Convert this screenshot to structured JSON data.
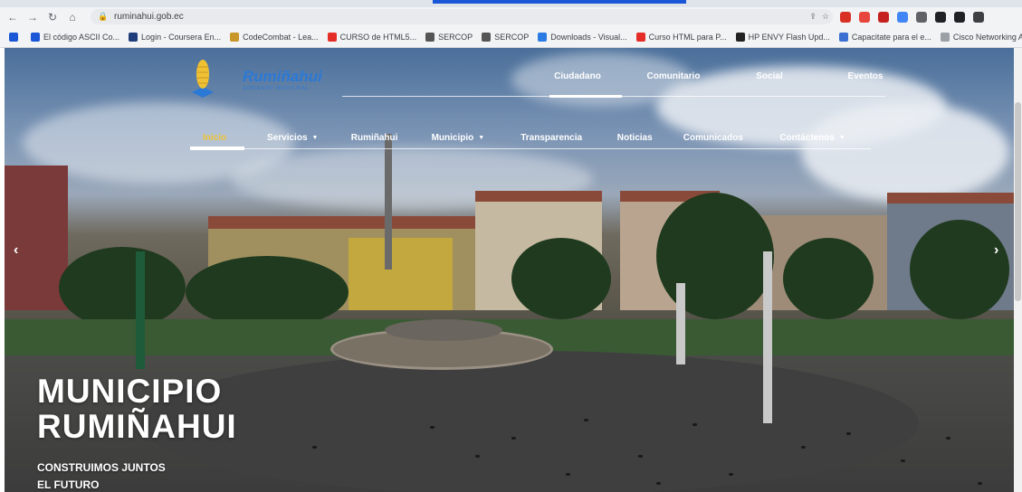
{
  "browser": {
    "url": "ruminahui.gob.ec",
    "bookmarks": [
      {
        "label": "El código ASCII Co...",
        "color": "#1a57d6"
      },
      {
        "label": "Login - Coursera En...",
        "color": "#1f3d7a"
      },
      {
        "label": "CodeCombat - Lea...",
        "color": "#c9962a"
      },
      {
        "label": "CURSO de HTML5...",
        "color": "#e52d27"
      },
      {
        "label": "SERCOP",
        "color": "#555555"
      },
      {
        "label": "SERCOP",
        "color": "#555555"
      },
      {
        "label": "Downloads - Visual...",
        "color": "#2a7be4"
      },
      {
        "label": "Curso HTML para P...",
        "color": "#e52d27"
      },
      {
        "label": "HP ENVY Flash Upd...",
        "color": "#222222"
      },
      {
        "label": "Capacitate para el e...",
        "color": "#3b6fd1"
      },
      {
        "label": "Cisco Networking A...",
        "color": "#9aa0a6"
      }
    ],
    "extension_colors": [
      "#d93025",
      "#e8453c",
      "#c5221f",
      "#4285f4",
      "#5f6368",
      "#202124",
      "#202124",
      "#3c4043"
    ]
  },
  "site": {
    "logo_name": "Rumiñahui",
    "logo_subtitle": "GOBIERNO MUNICIPAL",
    "top_nav": [
      "Ciudadano",
      "Comunitario",
      "Social",
      "Eventos"
    ],
    "main_nav": [
      {
        "label": "Inicio",
        "active": true,
        "dropdown": false
      },
      {
        "label": "Servicios",
        "active": false,
        "dropdown": true
      },
      {
        "label": "Rumiñahui",
        "active": false,
        "dropdown": false
      },
      {
        "label": "Municipio",
        "active": false,
        "dropdown": true
      },
      {
        "label": "Transparencia",
        "active": false,
        "dropdown": false
      },
      {
        "label": "Noticias",
        "active": false,
        "dropdown": false
      },
      {
        "label": "Comunicados",
        "active": false,
        "dropdown": false
      },
      {
        "label": "Contáctenos",
        "active": false,
        "dropdown": true
      }
    ],
    "hero": {
      "title_line1": "MUNICIPIO",
      "title_line2": "RUMIÑAHUI",
      "subtitle_line1": "CONSTRUIMOS JUNTOS",
      "subtitle_line2": "EL FUTURO",
      "prev_arrow": "‹",
      "next_arrow": "›"
    },
    "colors": {
      "accent": "#f0c233",
      "brand_blue": "#2a79d6"
    }
  }
}
